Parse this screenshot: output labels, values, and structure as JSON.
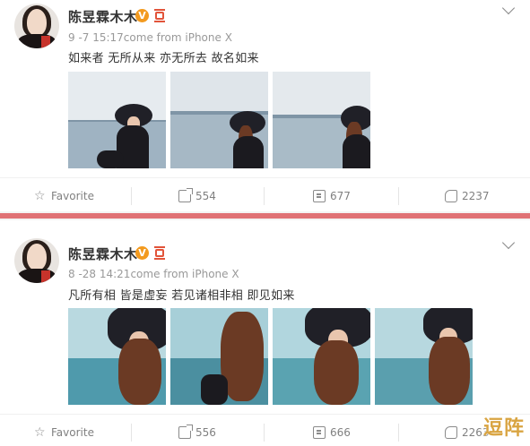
{
  "posts": [
    {
      "name": "陈昱霖木木",
      "meta": "9 -7 15:17come from iPhone X",
      "text": "如来者  无所从来  亦无所去  故名如来",
      "actions": {
        "favorite": "Favorite",
        "share": "554",
        "comment": "677",
        "like": "2237"
      }
    },
    {
      "name": "陈昱霖木木",
      "meta": "8 -28 14:21come from iPhone X",
      "text": "凡所有相  皆是虚妄  若见诸相非相  即见如来",
      "actions": {
        "favorite": "Favorite",
        "share": "556",
        "comment": "666",
        "like": "2263"
      }
    }
  ],
  "badge": {
    "v": "V"
  },
  "watermark": "逗阵",
  "icons": [
    "chevron-down-icon",
    "star-icon",
    "share-icon",
    "comment-icon",
    "like-icon",
    "verified-icon",
    "medal-icon"
  ],
  "colors": {
    "accent_red": "#e07275",
    "verified": "#f39a1e",
    "text_gray": "#808080",
    "name": "#333333"
  }
}
